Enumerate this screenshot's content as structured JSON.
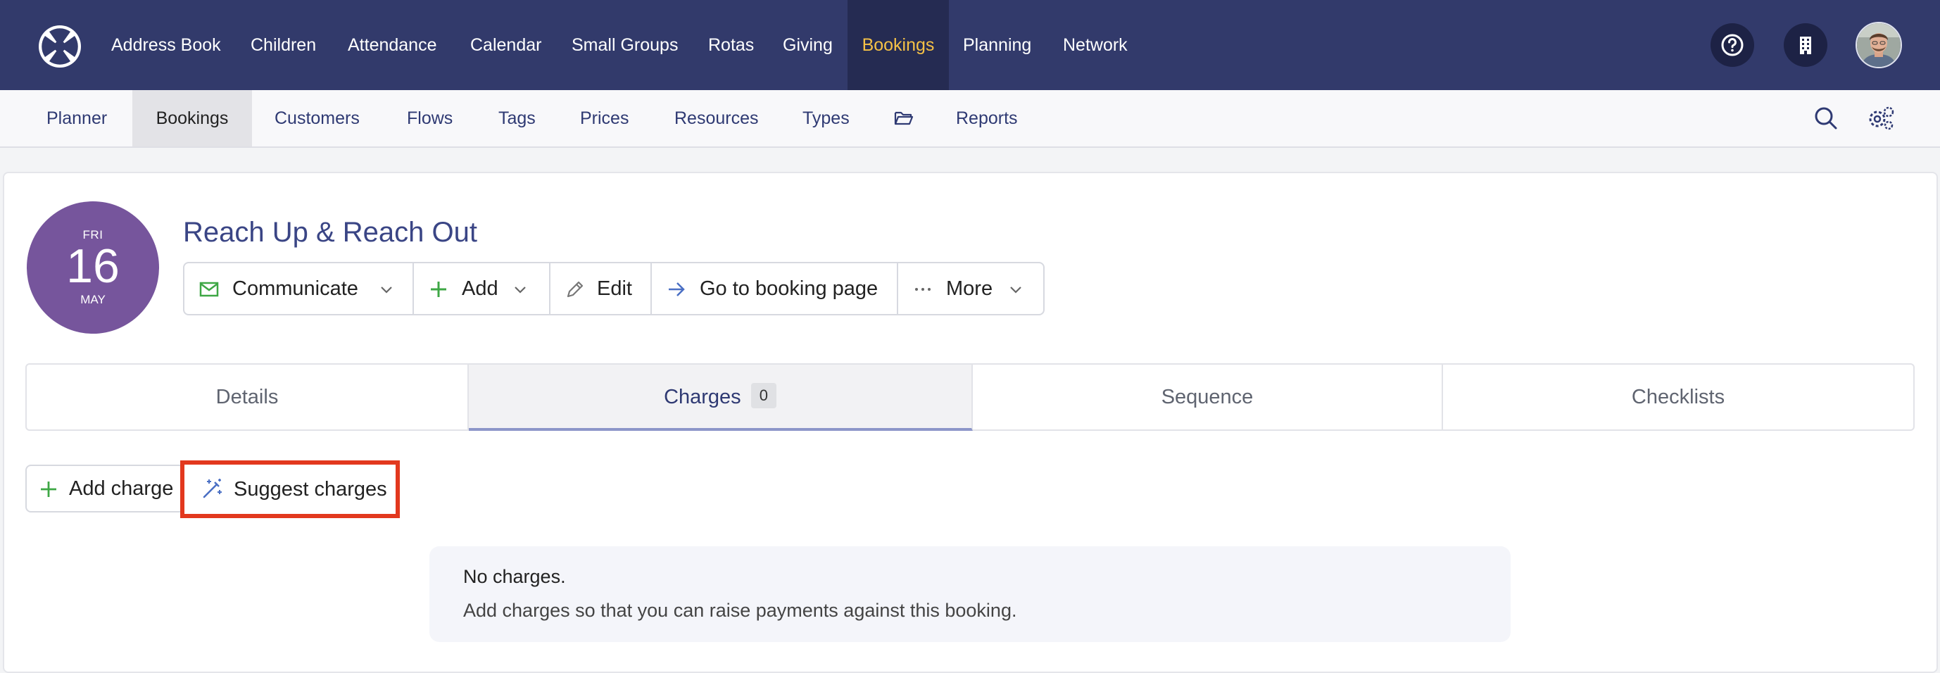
{
  "topnav": {
    "items": [
      "Address Book",
      "Children",
      "Attendance",
      "Calendar",
      "Small Groups",
      "Rotas",
      "Giving",
      "Bookings",
      "Planning",
      "Network"
    ],
    "active": "Bookings",
    "active_color": "#f5c146",
    "background": "#323a6b",
    "icons": [
      "logo-icon",
      "help-icon",
      "building-icon",
      "avatar"
    ]
  },
  "subnav": {
    "items": [
      "Planner",
      "Bookings",
      "Customers",
      "Flows",
      "Tags",
      "Prices",
      "Resources",
      "Types",
      "Reports"
    ],
    "active": "Bookings",
    "icons": [
      "folder-icon",
      "search-icon",
      "settings-icon"
    ]
  },
  "booking": {
    "date": {
      "dow": "FRI",
      "day": "16",
      "month": "MAY"
    },
    "badge_color": "#76559c",
    "title": "Reach Up & Reach Out",
    "actions": {
      "communicate": "Communicate",
      "add": "Add",
      "edit": "Edit",
      "goto": "Go to booking page",
      "more": "More"
    }
  },
  "tabs": {
    "details": "Details",
    "charges": "Charges",
    "charges_count": "0",
    "sequence": "Sequence",
    "checklists": "Checklists",
    "active": "Charges"
  },
  "charges": {
    "add_label": "Add charge",
    "suggest_label": "Suggest charges",
    "highlight_color": "#e2381e",
    "empty_title": "No charges.",
    "empty_text": "Add charges so that you can raise payments against this booking."
  }
}
